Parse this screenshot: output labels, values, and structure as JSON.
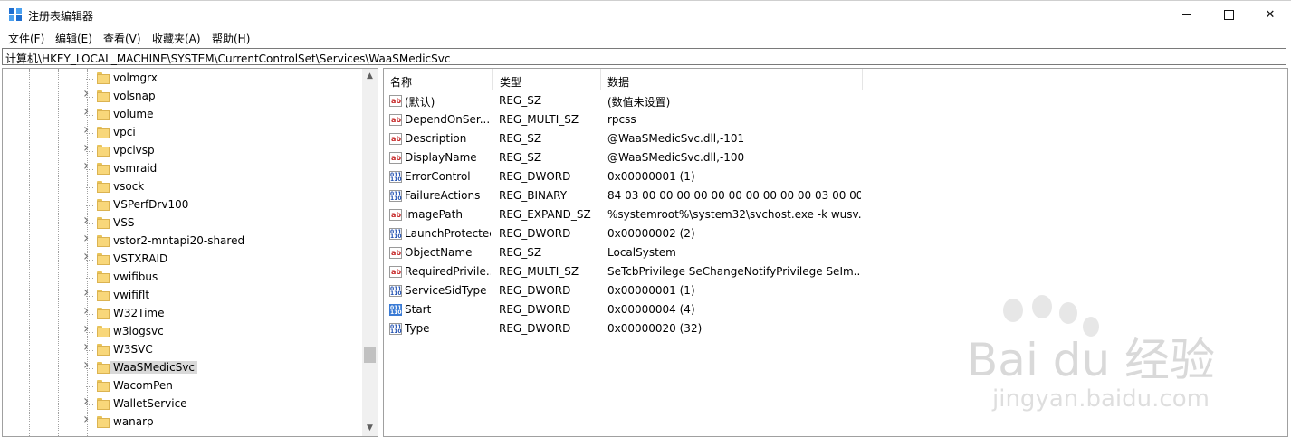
{
  "window": {
    "title": "注册表编辑器"
  },
  "menu": [
    "文件(F)",
    "编辑(E)",
    "查看(V)",
    "收藏夹(A)",
    "帮助(H)"
  ],
  "address": "计算机\\HKEY_LOCAL_MACHINE\\SYSTEM\\CurrentControlSet\\Services\\WaaSMedicSvc",
  "tree": {
    "items": [
      {
        "label": "volmgrx",
        "expandable": false
      },
      {
        "label": "volsnap",
        "expandable": true
      },
      {
        "label": "volume",
        "expandable": true
      },
      {
        "label": "vpci",
        "expandable": true
      },
      {
        "label": "vpcivsp",
        "expandable": true
      },
      {
        "label": "vsmraid",
        "expandable": true
      },
      {
        "label": "vsock",
        "expandable": false
      },
      {
        "label": "VSPerfDrv100",
        "expandable": false
      },
      {
        "label": "VSS",
        "expandable": true
      },
      {
        "label": "vstor2-mntapi20-shared",
        "expandable": true
      },
      {
        "label": "VSTXRAID",
        "expandable": true
      },
      {
        "label": "vwifibus",
        "expandable": false
      },
      {
        "label": "vwififlt",
        "expandable": true
      },
      {
        "label": "W32Time",
        "expandable": true
      },
      {
        "label": "w3logsvc",
        "expandable": true
      },
      {
        "label": "W3SVC",
        "expandable": true
      },
      {
        "label": "WaaSMedicSvc",
        "expandable": true,
        "selected": true
      },
      {
        "label": "WacomPen",
        "expandable": false
      },
      {
        "label": "WalletService",
        "expandable": true
      },
      {
        "label": "wanarp",
        "expandable": true
      }
    ],
    "scroll_position": 0.82
  },
  "columns": {
    "name": "名称",
    "type": "类型",
    "data": "数据"
  },
  "values": [
    {
      "icon": "string-value-icon",
      "name": "(默认)",
      "type": "REG_SZ",
      "data": "(数值未设置)"
    },
    {
      "icon": "string-value-icon",
      "name": "DependOnSer...",
      "type": "REG_MULTI_SZ",
      "data": "rpcss"
    },
    {
      "icon": "string-value-icon",
      "name": "Description",
      "type": "REG_SZ",
      "data": "@WaaSMedicSvc.dll,-101"
    },
    {
      "icon": "string-value-icon",
      "name": "DisplayName",
      "type": "REG_SZ",
      "data": "@WaaSMedicSvc.dll,-100"
    },
    {
      "icon": "binary-value-icon",
      "name": "ErrorControl",
      "type": "REG_DWORD",
      "data": "0x00000001 (1)"
    },
    {
      "icon": "binary-value-icon",
      "name": "FailureActions",
      "type": "REG_BINARY",
      "data": "84 03 00 00 00 00 00 00 00 00 00 00 03 00 00..."
    },
    {
      "icon": "string-value-icon",
      "name": "ImagePath",
      "type": "REG_EXPAND_SZ",
      "data": "%systemroot%\\system32\\svchost.exe -k wusv..."
    },
    {
      "icon": "binary-value-icon",
      "name": "LaunchProtected",
      "type": "REG_DWORD",
      "data": "0x00000002 (2)"
    },
    {
      "icon": "string-value-icon",
      "name": "ObjectName",
      "type": "REG_SZ",
      "data": "LocalSystem"
    },
    {
      "icon": "string-value-icon",
      "name": "RequiredPrivile...",
      "type": "REG_MULTI_SZ",
      "data": "SeTcbPrivilege SeChangeNotifyPrivilege SeIm..."
    },
    {
      "icon": "binary-value-icon",
      "name": "ServiceSidType",
      "type": "REG_DWORD",
      "data": "0x00000001 (1)"
    },
    {
      "icon": "binary-value-icon",
      "name": "Start",
      "type": "REG_DWORD",
      "data": "0x00000004 (4)",
      "selected": true
    },
    {
      "icon": "binary-value-icon",
      "name": "Type",
      "type": "REG_DWORD",
      "data": "0x00000020 (32)"
    }
  ],
  "watermark": {
    "text": "Bai du 经验",
    "url": "jingyan.baidu.com"
  }
}
